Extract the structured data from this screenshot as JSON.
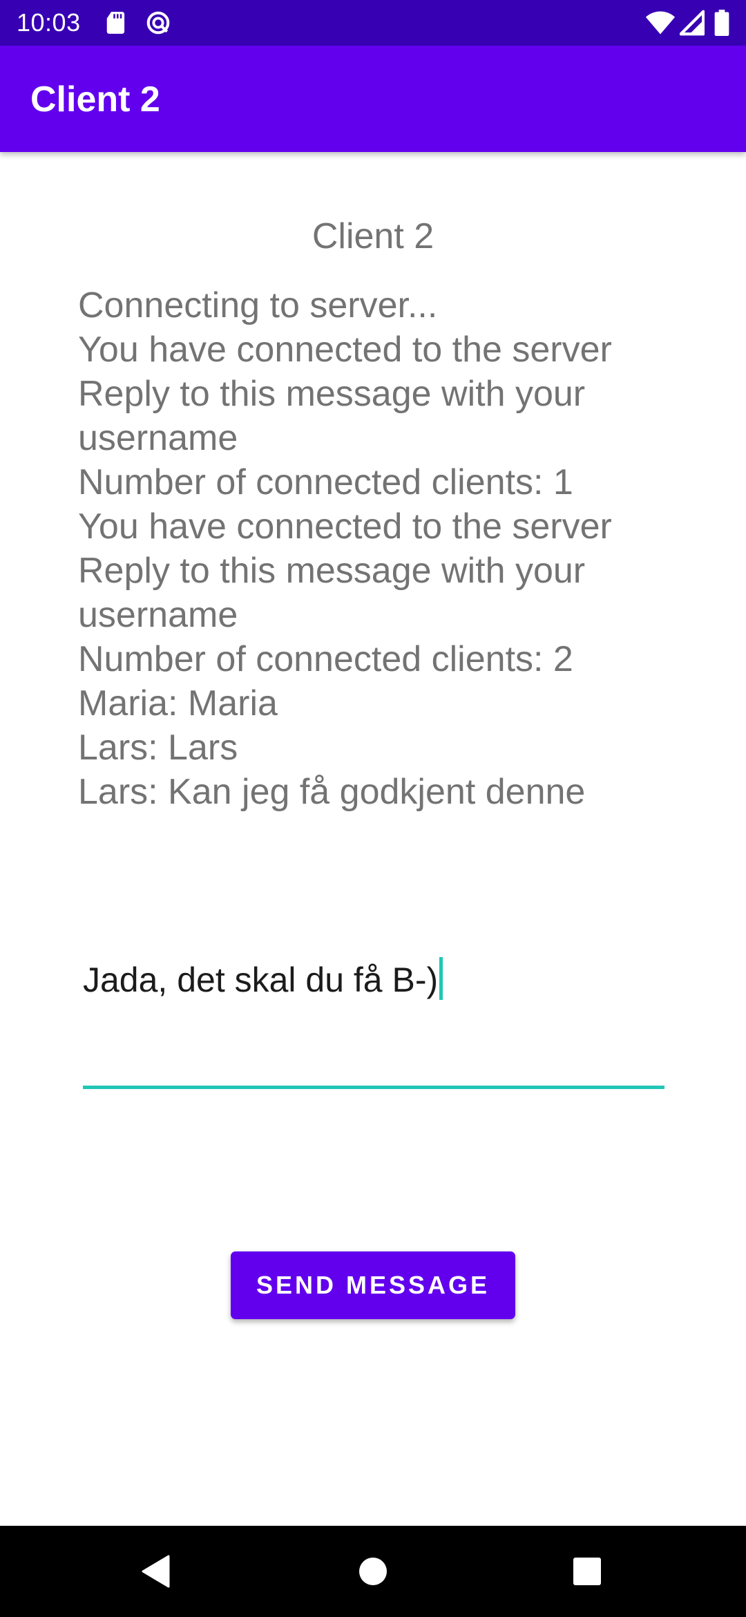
{
  "status_bar": {
    "time": "10:03",
    "icons": [
      "sd-card-icon",
      "nfc-icon",
      "wifi-icon",
      "signal-icon",
      "battery-icon"
    ]
  },
  "app_bar": {
    "title": "Client 2"
  },
  "main": {
    "heading": "Client 2",
    "messages": [
      "Connecting to server...",
      "You have connected to the server",
      "Reply to this message with your username",
      "Number of connected clients: 1",
      "You have connected to the server",
      "Reply to this message with your username",
      "Number of connected clients: 2",
      "Maria: Maria",
      "Lars: Lars",
      "Lars: Kan jeg få godkjent denne"
    ],
    "input_value": "Jada, det skal du få B-)",
    "send_button_label": "SEND MESSAGE"
  },
  "nav_bar": {
    "icons": [
      "back-icon",
      "home-icon",
      "recents-icon"
    ]
  },
  "colors": {
    "status_bar": "#3700b3",
    "app_bar": "#6200ee",
    "accent": "#20c6b6",
    "text_secondary": "#737373"
  }
}
